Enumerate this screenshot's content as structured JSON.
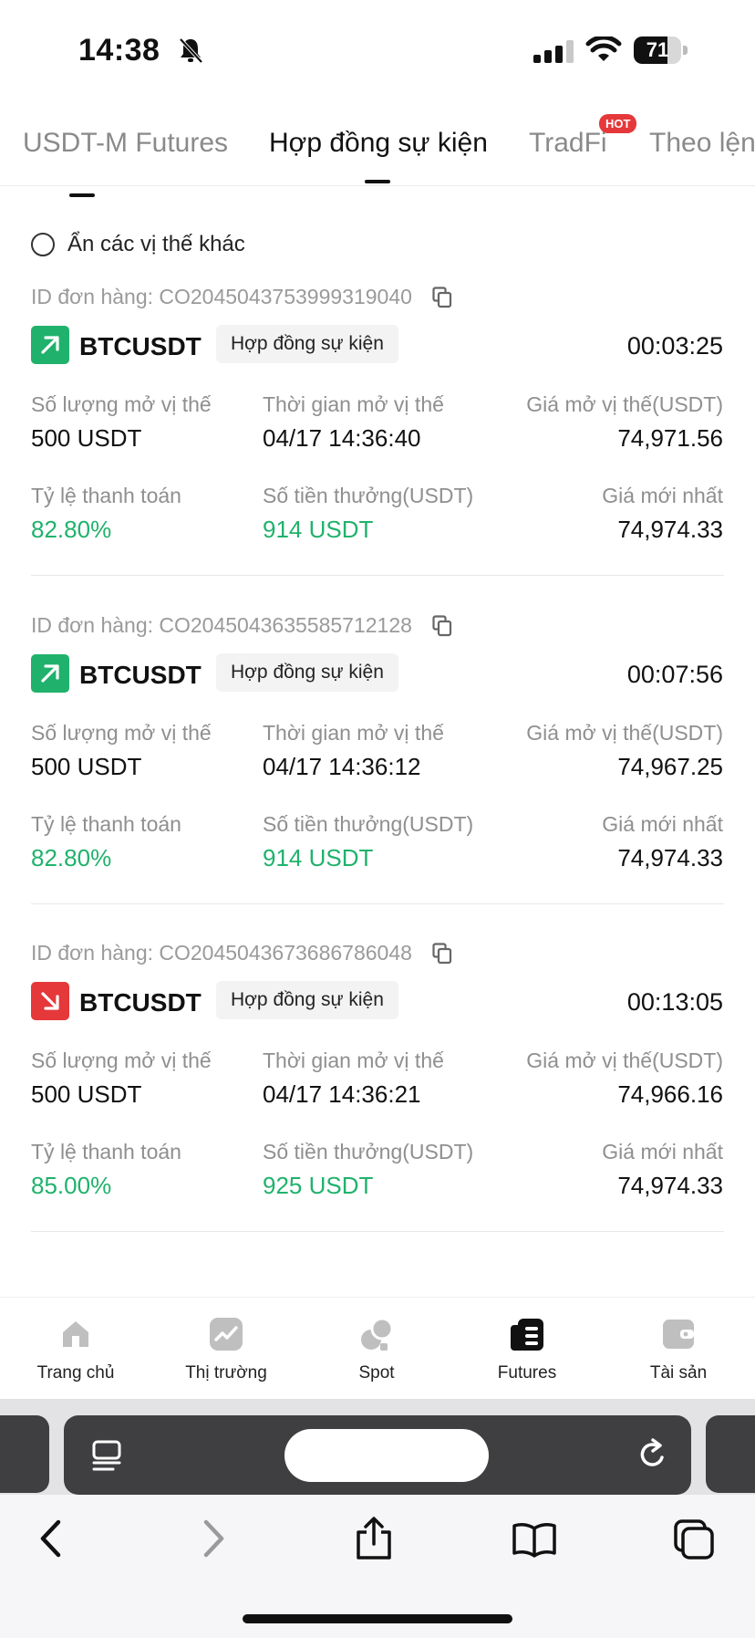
{
  "status_bar": {
    "time": "14:38",
    "battery": "71",
    "battery_level": 0.71
  },
  "tabs": [
    {
      "label": "USDT-M Futures",
      "active": false
    },
    {
      "label": "Hợp đồng sự kiện",
      "active": true
    },
    {
      "label": "TradFi",
      "active": false,
      "badge": "HOT"
    },
    {
      "label": "Theo lện",
      "active": false
    }
  ],
  "filter": {
    "label": "Ẩn các vị thế khác"
  },
  "labels": {
    "open_qty": "Số lượng mở vị thế",
    "open_time": "Thời gian mở vị thế",
    "open_price": "Giá mở vị thế(USDT)",
    "payout_rate": "Tỷ lệ thanh toán",
    "reward": "Số tiền thưởng(USDT)",
    "latest_price": "Giá mới nhất"
  },
  "orders": [
    {
      "order_id": "ID đơn hàng: CO2045043753999319040",
      "direction": "up",
      "pair": "BTCUSDT",
      "tag": "Hợp đồng sự kiện",
      "timer": "00:03:25",
      "open_qty": "500 USDT",
      "open_time": "04/17 14:36:40",
      "open_price": "74,971.56",
      "payout_rate": "82.80%",
      "reward": "914 USDT",
      "latest_price": "74,974.33"
    },
    {
      "order_id": "ID đơn hàng: CO2045043635585712128",
      "direction": "up",
      "pair": "BTCUSDT",
      "tag": "Hợp đồng sự kiện",
      "timer": "00:07:56",
      "open_qty": "500 USDT",
      "open_time": "04/17 14:36:12",
      "open_price": "74,967.25",
      "payout_rate": "82.80%",
      "reward": "914 USDT",
      "latest_price": "74,974.33"
    },
    {
      "order_id": "ID đơn hàng: CO2045043673686786048",
      "direction": "down",
      "pair": "BTCUSDT",
      "tag": "Hợp đồng sự kiện",
      "timer": "00:13:05",
      "open_qty": "500 USDT",
      "open_time": "04/17 14:36:21",
      "open_price": "74,966.16",
      "payout_rate": "85.00%",
      "reward": "925 USDT",
      "latest_price": "74,974.33"
    }
  ],
  "bottom_nav": [
    {
      "label": "Trang chủ",
      "icon": "home-icon"
    },
    {
      "label": "Thị trường",
      "icon": "market-icon"
    },
    {
      "label": "Spot",
      "icon": "spot-icon"
    },
    {
      "label": "Futures",
      "icon": "futures-icon",
      "active": true
    },
    {
      "label": "Tài sản",
      "icon": "wallet-icon"
    }
  ],
  "colors": {
    "green": "#20b26c",
    "red": "#e5383b"
  }
}
